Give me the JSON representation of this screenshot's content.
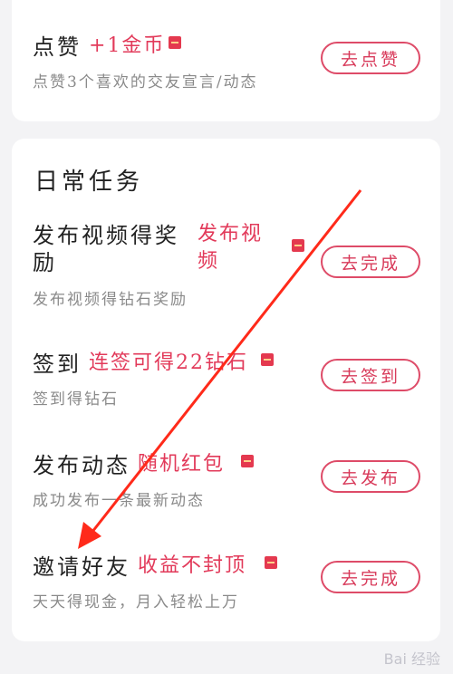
{
  "tasks_top": [
    {
      "title": "点赞",
      "reward": "+1金币",
      "desc": "点赞3个喜欢的交友宣言/动态",
      "button": "去点赞"
    }
  ],
  "daily": {
    "section_title": "日常任务",
    "tasks": [
      {
        "title_line1": "发布视频得奖",
        "title_line2": "励",
        "reward_line1": "发布视",
        "reward_line2": "频",
        "desc": "发布视频得钻石奖励",
        "button": "去完成"
      },
      {
        "title": "签到",
        "reward": "连签可得22钻石",
        "desc": "签到得钻石",
        "button": "去签到"
      },
      {
        "title": "发布动态",
        "reward": "随机红包",
        "desc": "成功发布一条最新动态",
        "button": "去发布"
      },
      {
        "title": "邀请好友",
        "reward": "收益不封顶",
        "desc": "天天得现金，月入轻松上万",
        "button": "去完成"
      }
    ]
  },
  "watermark": "Bai 经验",
  "colors": {
    "accent": "#de4b68",
    "reward_text": "#e23a5a",
    "annotation_arrow": "#ff2a1a"
  }
}
